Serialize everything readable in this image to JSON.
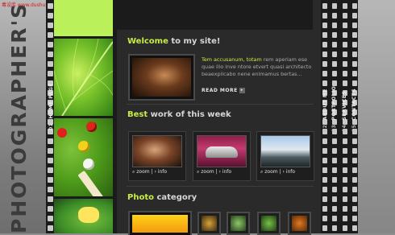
{
  "watermark": "毒设库 www.dushuku.com",
  "vertical_title": "PHOTOGRAPHER'S PORTFOLIO",
  "left_nav": {
    "number": "01",
    "label": "HOME PAGE"
  },
  "right_nav": [
    {
      "number": "02",
      "label": "ABOUT ME"
    },
    {
      "number": "03",
      "label": "PORTFOLIO"
    },
    {
      "number": "04",
      "label": "SERVICES"
    },
    {
      "number": "05",
      "label": "CONTACTS"
    }
  ],
  "welcome": {
    "title_highlight": "Welcome",
    "title_rest": " to my site!",
    "text_highlight": "Tem accusanum, totam",
    "text_rest": " rem aperiam ese quae illo inve ntore etvert quasi architecto beaexplicabo nene enimamus bertas...",
    "read_more": "READ MORE",
    "read_more_icon": "arrow-right-icon"
  },
  "best_work": {
    "title_highlight": "Best",
    "title_rest": "  work of this week",
    "cards": [
      {
        "zoom_label": "zoom",
        "info_label": "info",
        "image": "woman-portrait"
      },
      {
        "zoom_label": "zoom",
        "info_label": "info",
        "image": "silver-sports-car"
      },
      {
        "zoom_label": "zoom",
        "info_label": "info",
        "image": "waterfall-landscape"
      }
    ]
  },
  "photo_category": {
    "title_highlight": "Photo",
    "title_rest": " category"
  },
  "colors": {
    "accent": "#c9ec46",
    "background": "#2a2a2a",
    "film": "#1b1b1b"
  }
}
